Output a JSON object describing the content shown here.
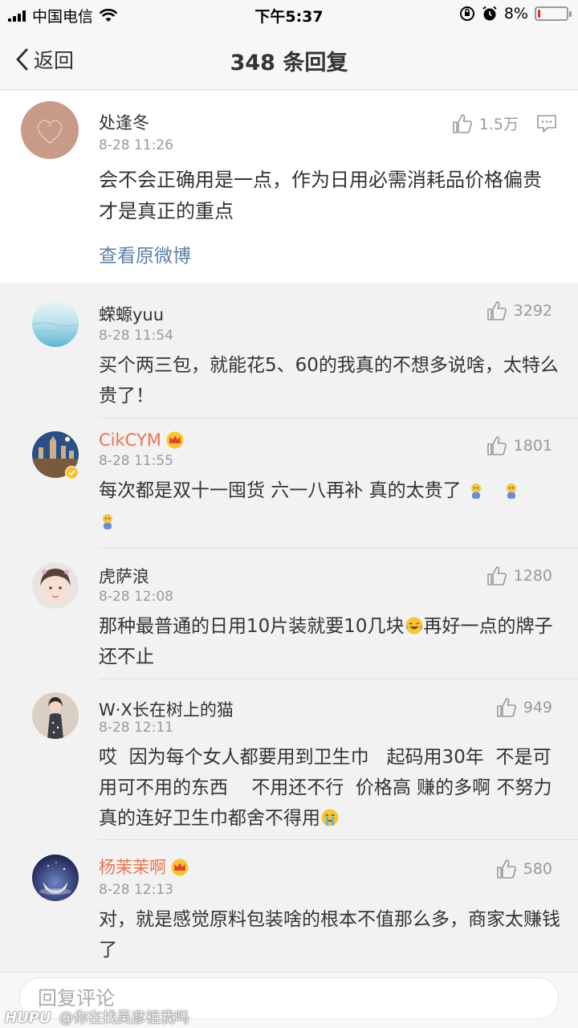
{
  "status_bar": {
    "carrier": "中国电信",
    "time": "下午5:37",
    "battery": "8%",
    "battery_level": 0.08
  },
  "nav": {
    "back_label": "返回",
    "title": "348 条回复"
  },
  "main_comment": {
    "username": "处逢冬",
    "time": "8-28 11:26",
    "likes": "1.5万",
    "text": "会不会正确用是一点，作为日用必需消耗品价格偏贵才是真正的重点",
    "view_original": "查看原微博"
  },
  "replies": [
    {
      "username": "蝾螈yuu",
      "time": "8-28 11:54",
      "likes": "3292",
      "text": "买个两三包，就能花5、60的我真的不想多说啥，太特么贵了！"
    },
    {
      "username": "CikCYM",
      "time": "8-28 11:55",
      "likes": "1801",
      "text": "每次都是双十一囤货 六一八再补 真的太贵了"
    },
    {
      "username": "虎萨浪",
      "time": "8-28 12:08",
      "likes": "1280",
      "text_a": "那种最普通的日用10片装就要10几块",
      "text_b": "再好一点的牌子还不止"
    },
    {
      "username": "W·X长在树上的猫",
      "time": "8-28 12:11",
      "likes": "949",
      "text": "哎  因为每个女人都要用到卫生巾   起码用30年  不是可用可不用的东西    不用还不行  价格高 赚的多啊 不努力真的连好卫生巾都舍不得用"
    },
    {
      "username": "杨茉茉啊",
      "time": "8-28 12:13",
      "likes": "580",
      "text": "对，就是感觉原料包装啥的根本不值那么多，商家太赚钱了"
    }
  ],
  "reply_input": {
    "placeholder": "回复评论"
  },
  "watermark": {
    "brand": "HUPU",
    "text": "@你在找吴彦祖我吗"
  },
  "colors": {
    "vip_name": "#eb7350",
    "link": "#5b7fa6",
    "battery_low": "#e0342b"
  }
}
